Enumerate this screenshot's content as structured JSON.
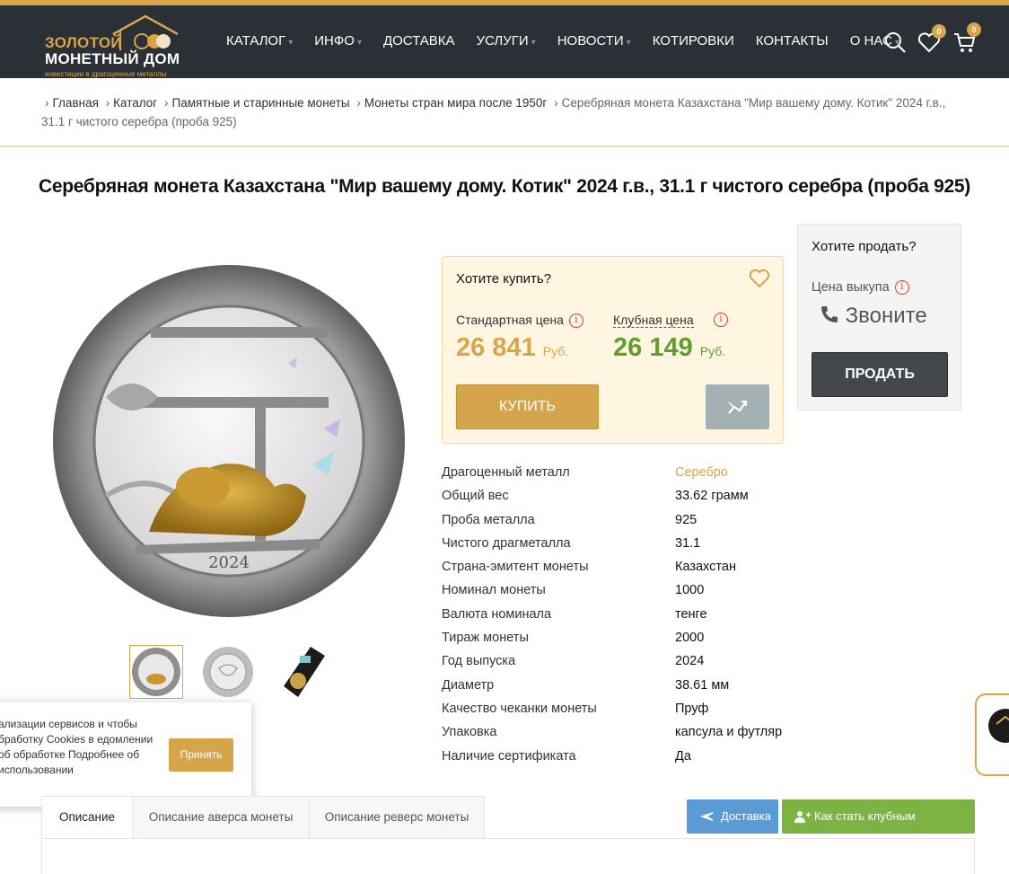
{
  "header": {
    "logo_line1": "ЗОЛОТОЙ",
    "logo_line2": "МОНЕТНЫЙ ДОМ",
    "logo_tagline": "инвестиции в драгоценные металлы",
    "nav": [
      {
        "label": "КАТАЛОГ",
        "dropdown": true
      },
      {
        "label": "ИНФО",
        "dropdown": true
      },
      {
        "label": "ДОСТАВКА",
        "dropdown": false
      },
      {
        "label": "УСЛУГИ",
        "dropdown": true
      },
      {
        "label": "НОВОСТИ",
        "dropdown": true
      },
      {
        "label": "КОТИРОВКИ",
        "dropdown": false
      },
      {
        "label": "КОНТАКТЫ",
        "dropdown": false
      },
      {
        "label": "О НАС",
        "dropdown": true
      }
    ],
    "caret": "▾",
    "favorites_count": "0",
    "cart_count": "0",
    "icons": {
      "search": "search-icon",
      "favorites": "heart-icon",
      "cart": "cart-icon"
    }
  },
  "breadcrumb": {
    "items": [
      "Главная",
      "Каталог",
      "Памятные и старинные монеты",
      "Монеты стран мира после 1950г"
    ],
    "separator": "›",
    "current": "Серебряная монета Казахстана \"Мир вашему дому. Котик\" 2024 г.в., 31.1 г чистого серебра (проба 925)"
  },
  "product": {
    "title": "Серебряная монета Казахстана \"Мир вашему дому. Котик\" 2024 г.в., 31.1 г чистого серебра (проба 925)",
    "coin_year": "2024"
  },
  "buy": {
    "title": "Хотите купить?",
    "standard_label": "Стандартная цена",
    "standard_price": "26 841",
    "club_label": "Клубная цена",
    "club_price": "26 149",
    "currency": "Руб.",
    "info_glyph": "i",
    "buy_button": "КУПИТЬ"
  },
  "sell": {
    "title": "Хотите продать?",
    "buyback_label": "Цена выкупа",
    "call_text": "Звоните",
    "sell_button": "ПРОДАТЬ"
  },
  "specs": [
    {
      "k": "Драгоценный металл",
      "v": "Серебро"
    },
    {
      "k": "Общий вес",
      "v": "33.62 грамм"
    },
    {
      "k": "Проба металла",
      "v": "925"
    },
    {
      "k": "Чистого драгметалла",
      "v": "31.1"
    },
    {
      "k": "Страна-эмитент монеты",
      "v": "Казахстан"
    },
    {
      "k": "Номинал монеты",
      "v": "1000"
    },
    {
      "k": "Валюта номинала",
      "v": "тенге"
    },
    {
      "k": "Тираж монеты",
      "v": "2000"
    },
    {
      "k": "Год выпуска",
      "v": "2024"
    },
    {
      "k": "Диаметр",
      "v": "38.61 мм"
    },
    {
      "k": "Качество чеканки монеты",
      "v": "Пруф"
    },
    {
      "k": "Упаковка",
      "v": "капсула и футляр"
    },
    {
      "k": "Наличие сертификата",
      "v": "Да"
    }
  ],
  "cookie": {
    "text": "ализации сервисов и чтобы бработку Cookies в едомлении об обработке Подробнее об использовании",
    "accept": "Принять"
  },
  "tabs": [
    "Описание",
    "Описание аверса монеты",
    "Описание реверс монеты"
  ],
  "actions": {
    "delivery": "Доставка",
    "club": "Как стать клубным клиентом?"
  },
  "colors": {
    "gold": "#d8a54a",
    "header_bg": "#2b2f36",
    "club_green": "#5f9e2e",
    "delivery_blue": "#5b9bd5",
    "club_btn_green": "#7cb342"
  }
}
